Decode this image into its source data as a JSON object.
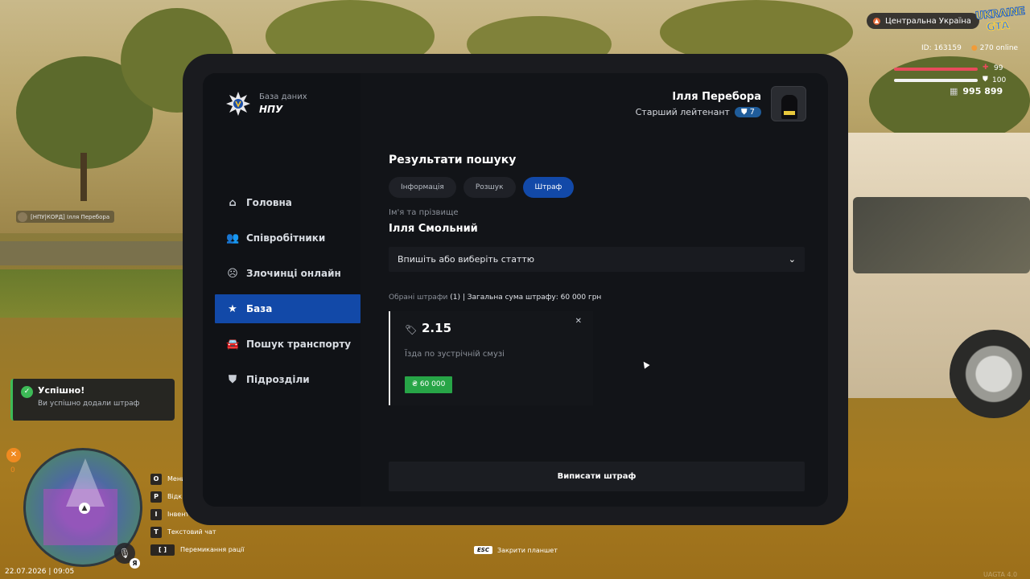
{
  "hud": {
    "region": "Центральна Україна",
    "game_logo_line1": "UKRAINE",
    "game_logo_line2": "GTA",
    "player_id": "ID: 163159",
    "online": "270 online",
    "health": "99",
    "armor": "100",
    "money": "995 899",
    "nametag": "[НПУ|КОРД] Ілля Перебора",
    "hunger": "0",
    "datetime": "22.07.2026 | 09:05",
    "mic_key": "Я",
    "version": "UAGTA 4.0",
    "colors": {
      "health": "#e84b5c",
      "armor": "#f2f2f2",
      "success": "#3dbb57",
      "accent": "#1249a8"
    }
  },
  "toast": {
    "title": "Успішно!",
    "message": "Ви успішно додали штраф"
  },
  "keys": [
    {
      "key": "O",
      "label": "Мени"
    },
    {
      "key": "P",
      "label": "Відк"
    },
    {
      "key": "I",
      "label": "Інвент"
    },
    {
      "key": "T",
      "label": "Текстовий чат"
    },
    {
      "key": "[ ]",
      "label": "Перемикання рації"
    }
  ],
  "esc_hint": {
    "key": "ESC",
    "label": "Закрити планшет"
  },
  "tablet": {
    "brand": {
      "subtitle": "База даних",
      "title": "НПУ"
    },
    "nav": [
      {
        "icon": "home-icon",
        "glyph": "⌂",
        "label": "Головна"
      },
      {
        "icon": "users-icon",
        "glyph": "👥",
        "label": "Співробітники"
      },
      {
        "icon": "criminal-icon",
        "glyph": "☹",
        "label": "Злочинці онлайн"
      },
      {
        "icon": "star-icon",
        "glyph": "★",
        "label": "База",
        "active": true
      },
      {
        "icon": "car-icon",
        "glyph": "🚘",
        "label": "Пошук транспорту"
      },
      {
        "icon": "shield-icon",
        "glyph": "⛊",
        "label": "Підрозділи"
      }
    ],
    "user": {
      "name": "Ілля Перебора",
      "rank": "Старший лейтенант",
      "level": "7"
    },
    "results": {
      "title": "Результати пошуку",
      "tabs": [
        "Інформація",
        "Розшук",
        "Штраф"
      ],
      "active_tab": "Штраф",
      "name_label": "Ім'я та прізвище",
      "name_value": "Ілля Смольний",
      "select_placeholder": "Впишіть або виберіть статтю",
      "summary_muted": "Обрані штрафи",
      "summary_text": "(1) | Загальна сума штрафу: 60 000 грн",
      "fine": {
        "article": "2.15",
        "description": "Їзда по зустрічній смузі",
        "amount": "₴ 60 000"
      },
      "submit_label": "Виписати штраф"
    }
  }
}
